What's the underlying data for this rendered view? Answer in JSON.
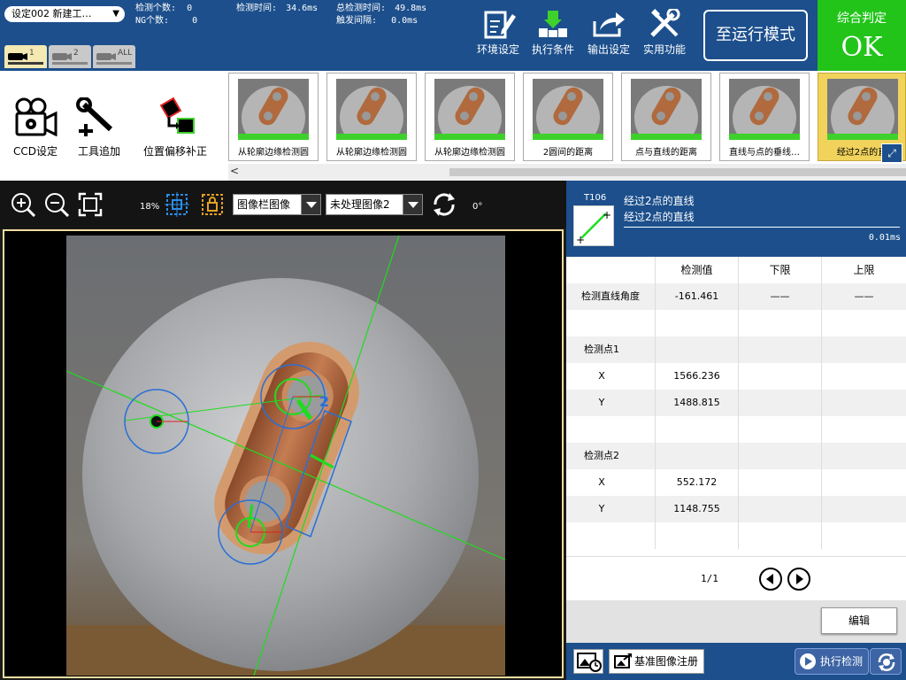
{
  "header": {
    "setting_select": "设定002 新建工…",
    "stats": {
      "detect_count_label": "检测个数:",
      "detect_count_value": "0",
      "ng_count_label": "NG个数:",
      "ng_count_value": "0",
      "detect_time_label": "检测时间:",
      "detect_time_value": "34.6ms",
      "total_time_label": "总检测时间:",
      "total_time_value": "49.8ms",
      "trigger_interval_label": "触发间隔:",
      "trigger_interval_value": "0.0ms"
    },
    "mode_tabs": [
      {
        "label": "1",
        "active": true
      },
      {
        "label": "2",
        "active": false
      },
      {
        "label": "ALL",
        "active": false
      }
    ],
    "buttons": [
      {
        "label": "环境设定",
        "icon": "doc-edit-icon"
      },
      {
        "label": "执行条件",
        "icon": "flow-arrows-icon"
      },
      {
        "label": "输出设定",
        "icon": "share-arrow-icon"
      },
      {
        "label": "实用功能",
        "icon": "wrench-screwdriver-icon"
      }
    ],
    "run_mode_label": "至运行模式",
    "judge_title": "综合判定",
    "judge_value": "OK"
  },
  "toolstrip": {
    "tools": [
      {
        "label": "CCD设定",
        "icon": "camera-gear-icon"
      },
      {
        "label": "工具追加",
        "icon": "wrench-plus-icon"
      },
      {
        "label": "位置偏移补正",
        "icon": "offset-correct-icon"
      }
    ],
    "thumbnails": [
      {
        "label": "从轮廓边缘检测圆",
        "active": false
      },
      {
        "label": "从轮廓边缘检测圆",
        "active": false
      },
      {
        "label": "从轮廓边缘检测圆",
        "active": false
      },
      {
        "label": "2圆间的距离",
        "active": false
      },
      {
        "label": "点与直线的距离",
        "active": false
      },
      {
        "label": "直线与点的垂线…",
        "active": false
      },
      {
        "label": "经过2点的直",
        "active": true
      }
    ],
    "scroll_left": "<"
  },
  "image_toolbar": {
    "zoom_level": "18%",
    "image_source": "图像栏图像",
    "image_type": "未处理图像2",
    "rotation": "0°"
  },
  "tool_panel": {
    "tool_id": "T106",
    "tool_name_1": "经过2点的直线",
    "tool_name_2": "经过2点的直线",
    "exec_time": "0.01ms",
    "columns": [
      "",
      "检测值",
      "下限",
      "上限"
    ],
    "rows": [
      {
        "name": "检测直线角度",
        "value": "-161.461",
        "lower": "——",
        "upper": "——"
      },
      {
        "name": "",
        "value": "",
        "lower": "",
        "upper": ""
      },
      {
        "name": "检测点1",
        "value": "",
        "lower": "",
        "upper": ""
      },
      {
        "name": "X",
        "value": "1566.236",
        "lower": "",
        "upper": ""
      },
      {
        "name": "Y",
        "value": "1488.815",
        "lower": "",
        "upper": ""
      },
      {
        "name": "",
        "value": "",
        "lower": "",
        "upper": ""
      },
      {
        "name": "检测点2",
        "value": "",
        "lower": "",
        "upper": ""
      },
      {
        "name": "X",
        "value": "552.172",
        "lower": "",
        "upper": ""
      },
      {
        "name": "Y",
        "value": "1148.755",
        "lower": "",
        "upper": ""
      },
      {
        "name": "",
        "value": "",
        "lower": "",
        "upper": ""
      }
    ],
    "page": "1/1",
    "edit_label": "编辑"
  },
  "bottom": {
    "register_label": "基准图像注册",
    "run_detect_label": "执行检测"
  },
  "colors": {
    "header_blue": "#1c4f8c",
    "ok_green": "#22c41a",
    "active_thumb": "#f1d35c",
    "overlay_green": "#1edc1e",
    "overlay_blue": "#2a6fd6",
    "overlay_red": "#e02020"
  }
}
